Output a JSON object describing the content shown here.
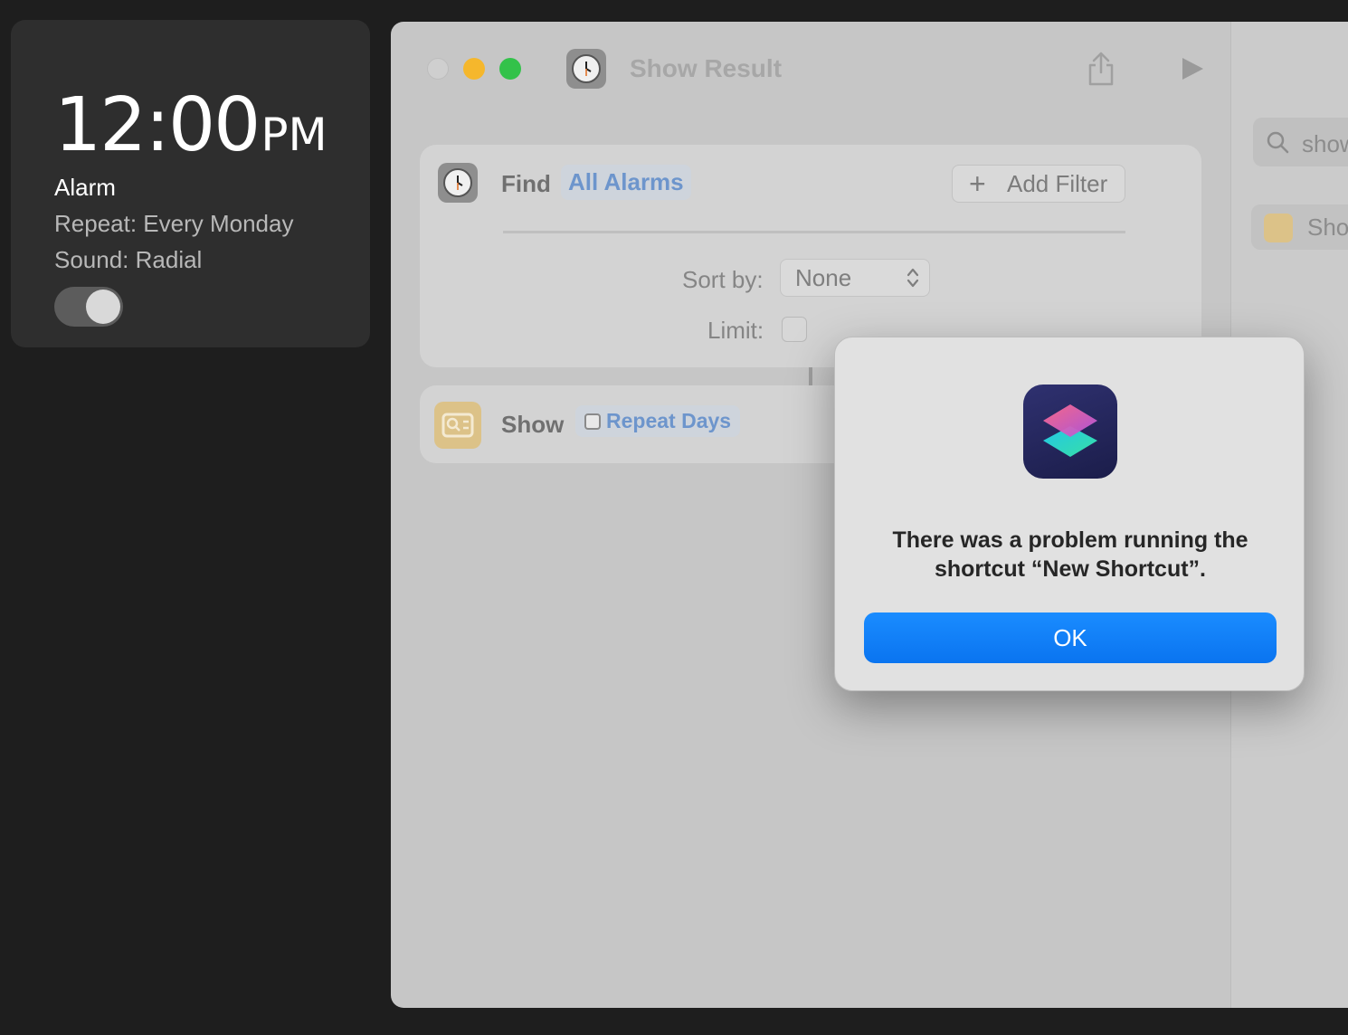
{
  "alarm_widget": {
    "time": "12:00",
    "ampm": "PM",
    "label": "Alarm",
    "repeat": "Repeat: Every Monday",
    "sound": "Sound: Radial",
    "enabled": true
  },
  "window": {
    "title": "Show Result",
    "find_action": {
      "label": "Find",
      "token": "All Alarms",
      "add_filter": "Add Filter",
      "sort_label": "Sort by:",
      "sort_value": "None",
      "limit_label": "Limit:"
    },
    "show_action": {
      "label": "Show",
      "token": "Repeat Days"
    },
    "sidebar": {
      "search_text": "show",
      "item_label": "Sho"
    }
  },
  "dialog": {
    "message": "There was a problem running the shortcut “New Shortcut”.",
    "ok_label": "OK"
  },
  "colors": {
    "accent": "#0a74f0",
    "traffic_min": "#f5b72c",
    "traffic_max": "#33c24a"
  },
  "icons": [
    "clock-icon",
    "share-icon",
    "play-icon",
    "plus-icon",
    "search-icon",
    "show-result-icon",
    "shortcuts-app-icon"
  ]
}
